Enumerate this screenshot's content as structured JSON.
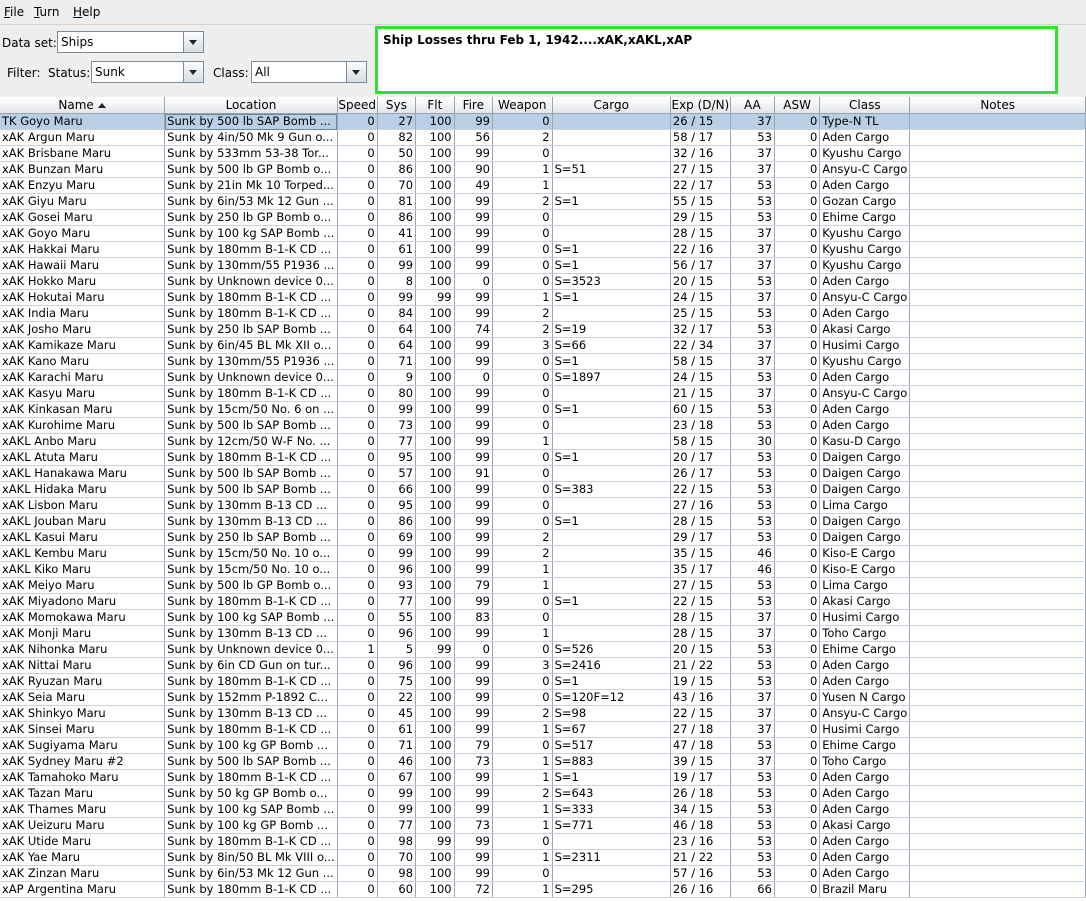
{
  "menu": {
    "file": "File",
    "turn": "Turn",
    "help": "Help"
  },
  "filters": {
    "dataset_label": "Data set:",
    "dataset_value": "Ships",
    "filter_label": "Filter:",
    "status_label": "Status:",
    "status_value": "Sunk",
    "class_label": "Class:",
    "class_value": "All"
  },
  "notes_text": "Ship Losses thru Feb 1, 1942....xAK,xAKL,xAP",
  "columns": [
    "Name",
    "Location",
    "Speed",
    "Sys",
    "Flt",
    "Fire",
    "Weapon",
    "Cargo",
    "Exp (D/N)",
    "AA",
    "ASW",
    "Class",
    "Notes"
  ],
  "rows": [
    [
      "TK Goyo Maru",
      "Sunk by 500 lb SAP Bomb ...",
      "0",
      "27",
      "100",
      "99",
      "0",
      "",
      "26 / 15",
      "37",
      "0",
      "Type-N TL",
      ""
    ],
    [
      "xAK Argun Maru",
      "Sunk by 4in/50 Mk 9 Gun o...",
      "0",
      "82",
      "100",
      "56",
      "2",
      "",
      "58 / 17",
      "53",
      "0",
      "Aden Cargo",
      ""
    ],
    [
      "xAK Brisbane Maru",
      "Sunk by 533mm 53-38 Tor...",
      "0",
      "50",
      "100",
      "99",
      "0",
      "",
      "32 / 16",
      "37",
      "0",
      "Kyushu Cargo",
      ""
    ],
    [
      "xAK Bunzan Maru",
      "Sunk by 500 lb GP Bomb o...",
      "0",
      "86",
      "100",
      "90",
      "1",
      "S=51",
      "27 / 15",
      "37",
      "0",
      "Ansyu-C Cargo",
      ""
    ],
    [
      "xAK Enzyu Maru",
      "Sunk by 21in Mk 10 Torped...",
      "0",
      "70",
      "100",
      "49",
      "1",
      "",
      "22 / 17",
      "53",
      "0",
      "Aden Cargo",
      ""
    ],
    [
      "xAK Giyu Maru",
      "Sunk by 6in/53 Mk 12 Gun ...",
      "0",
      "81",
      "100",
      "99",
      "2",
      "S=1",
      "55 / 15",
      "53",
      "0",
      "Gozan Cargo",
      ""
    ],
    [
      "xAK Gosei Maru",
      "Sunk by 250 lb GP Bomb o...",
      "0",
      "86",
      "100",
      "99",
      "0",
      "",
      "29 / 15",
      "53",
      "0",
      "Ehime Cargo",
      ""
    ],
    [
      "xAK Goyo Maru",
      "Sunk by 100 kg SAP Bomb ...",
      "0",
      "41",
      "100",
      "99",
      "0",
      "",
      "28 / 15",
      "37",
      "0",
      "Kyushu Cargo",
      ""
    ],
    [
      "xAK Hakkai Maru",
      "Sunk by 180mm B-1-K CD ...",
      "0",
      "61",
      "100",
      "99",
      "0",
      "S=1",
      "22 / 16",
      "37",
      "0",
      "Kyushu Cargo",
      ""
    ],
    [
      "xAK Hawaii Maru",
      "Sunk by 130mm/55 P1936 ...",
      "0",
      "99",
      "100",
      "99",
      "0",
      "S=1",
      "56 / 17",
      "37",
      "0",
      "Kyushu Cargo",
      ""
    ],
    [
      "xAK Hokko Maru",
      "Sunk by Unknown device 0...",
      "0",
      "8",
      "100",
      "0",
      "0",
      "S=3523",
      "20 / 15",
      "53",
      "0",
      "Aden Cargo",
      ""
    ],
    [
      "xAK Hokutai Maru",
      "Sunk by 180mm B-1-K CD ...",
      "0",
      "99",
      "99",
      "99",
      "1",
      "S=1",
      "24 / 15",
      "37",
      "0",
      "Ansyu-C Cargo",
      ""
    ],
    [
      "xAK India Maru",
      "Sunk by 180mm B-1-K CD ...",
      "0",
      "84",
      "100",
      "99",
      "2",
      "",
      "25 / 15",
      "53",
      "0",
      "Aden Cargo",
      ""
    ],
    [
      "xAK Josho Maru",
      "Sunk by 250 lb SAP Bomb ...",
      "0",
      "64",
      "100",
      "74",
      "2",
      "S=19",
      "32 / 17",
      "53",
      "0",
      "Akasi Cargo",
      ""
    ],
    [
      "xAK Kamikaze Maru",
      "Sunk by 6in/45 BL Mk XII o...",
      "0",
      "64",
      "100",
      "99",
      "3",
      "S=66",
      "22 / 34",
      "37",
      "0",
      "Husimi Cargo",
      ""
    ],
    [
      "xAK Kano Maru",
      "Sunk by 130mm/55 P1936 ...",
      "0",
      "71",
      "100",
      "99",
      "0",
      "S=1",
      "58 / 15",
      "37",
      "0",
      "Kyushu Cargo",
      ""
    ],
    [
      "xAK Karachi Maru",
      "Sunk by Unknown device 0...",
      "0",
      "9",
      "100",
      "0",
      "0",
      "S=1897",
      "24 / 15",
      "53",
      "0",
      "Aden Cargo",
      ""
    ],
    [
      "xAK Kasyu Maru",
      "Sunk by 180mm B-1-K CD ...",
      "0",
      "80",
      "100",
      "99",
      "0",
      "",
      "21 / 15",
      "37",
      "0",
      "Ansyu-C Cargo",
      ""
    ],
    [
      "xAK Kinkasan Maru",
      "Sunk by 15cm/50 No. 6 on ...",
      "0",
      "99",
      "100",
      "99",
      "0",
      "S=1",
      "60 / 15",
      "53",
      "0",
      "Aden Cargo",
      ""
    ],
    [
      "xAK Kurohime Maru",
      "Sunk by 500 lb SAP Bomb ...",
      "0",
      "73",
      "100",
      "99",
      "0",
      "",
      "23 / 18",
      "53",
      "0",
      "Aden Cargo",
      ""
    ],
    [
      "xAKL Anbo Maru",
      "Sunk by 12cm/50 W-F No. ...",
      "0",
      "77",
      "100",
      "99",
      "1",
      "",
      "58 / 15",
      "30",
      "0",
      "Kasu-D Cargo",
      ""
    ],
    [
      "xAKL Atuta Maru",
      "Sunk by 180mm B-1-K CD ...",
      "0",
      "95",
      "100",
      "99",
      "0",
      "S=1",
      "20 / 17",
      "53",
      "0",
      "Daigen Cargo",
      ""
    ],
    [
      "xAKL Hanakawa Maru",
      "Sunk by 500 lb SAP Bomb ...",
      "0",
      "57",
      "100",
      "91",
      "0",
      "",
      "26 / 17",
      "53",
      "0",
      "Daigen Cargo",
      ""
    ],
    [
      "xAKL Hidaka Maru",
      "Sunk by 500 lb SAP Bomb ...",
      "0",
      "66",
      "100",
      "99",
      "0",
      "S=383",
      "22 / 15",
      "53",
      "0",
      "Daigen Cargo",
      ""
    ],
    [
      "xAK Lisbon Maru",
      "Sunk by 130mm B-13 CD ...",
      "0",
      "95",
      "100",
      "99",
      "0",
      "",
      "27 / 16",
      "53",
      "0",
      "Lima Cargo",
      ""
    ],
    [
      "xAKL Jouban Maru",
      "Sunk by 130mm B-13 CD ...",
      "0",
      "86",
      "100",
      "99",
      "0",
      "S=1",
      "28 / 15",
      "53",
      "0",
      "Daigen Cargo",
      ""
    ],
    [
      "xAKL Kasui Maru",
      "Sunk by 250 lb SAP Bomb ...",
      "0",
      "69",
      "100",
      "99",
      "2",
      "",
      "29 / 17",
      "53",
      "0",
      "Daigen Cargo",
      ""
    ],
    [
      "xAKL Kembu Maru",
      "Sunk by 15cm/50 No. 10 o...",
      "0",
      "99",
      "100",
      "99",
      "2",
      "",
      "35 / 15",
      "46",
      "0",
      "Kiso-E Cargo",
      ""
    ],
    [
      "xAKL Kiko Maru",
      "Sunk by 15cm/50 No. 10 o...",
      "0",
      "96",
      "100",
      "99",
      "1",
      "",
      "35 / 17",
      "46",
      "0",
      "Kiso-E Cargo",
      ""
    ],
    [
      "xAK Meiyo Maru",
      "Sunk by 500 lb GP Bomb o...",
      "0",
      "93",
      "100",
      "79",
      "1",
      "",
      "27 / 15",
      "53",
      "0",
      "Lima Cargo",
      ""
    ],
    [
      "xAK Miyadono Maru",
      "Sunk by 180mm B-1-K CD ...",
      "0",
      "77",
      "100",
      "99",
      "0",
      "S=1",
      "22 / 15",
      "53",
      "0",
      "Akasi Cargo",
      ""
    ],
    [
      "xAK Momokawa Maru",
      "Sunk by 100 kg SAP Bomb ...",
      "0",
      "55",
      "100",
      "83",
      "0",
      "",
      "28 / 15",
      "37",
      "0",
      "Husimi Cargo",
      ""
    ],
    [
      "xAK Monji Maru",
      "Sunk by 130mm B-13 CD ...",
      "0",
      "96",
      "100",
      "99",
      "1",
      "",
      "28 / 15",
      "37",
      "0",
      "Toho Cargo",
      ""
    ],
    [
      "xAK Nihonka Maru",
      "Sunk by Unknown device 0...",
      "1",
      "5",
      "99",
      "0",
      "0",
      "S=526",
      "20 / 15",
      "53",
      "0",
      "Ehime Cargo",
      ""
    ],
    [
      "xAK Nittai Maru",
      "Sunk by 6in CD Gun on tur...",
      "0",
      "96",
      "100",
      "99",
      "3",
      "S=2416",
      "21 / 22",
      "53",
      "0",
      "Aden Cargo",
      ""
    ],
    [
      "xAK Ryuzan Maru",
      "Sunk by 180mm B-1-K CD ...",
      "0",
      "75",
      "100",
      "99",
      "0",
      "S=1",
      "19 / 15",
      "53",
      "0",
      "Aden Cargo",
      ""
    ],
    [
      "xAK Seia Maru",
      "Sunk by 152mm P-1892 C...",
      "0",
      "22",
      "100",
      "99",
      "0",
      "S=120F=12",
      "43 / 16",
      "37",
      "0",
      "Yusen N Cargo",
      ""
    ],
    [
      "xAK Shinkyo Maru",
      "Sunk by 130mm B-13 CD ...",
      "0",
      "45",
      "100",
      "99",
      "2",
      "S=98",
      "22 / 15",
      "37",
      "0",
      "Ansyu-C Cargo",
      ""
    ],
    [
      "xAK Sinsei Maru",
      "Sunk by 180mm B-1-K CD ...",
      "0",
      "61",
      "100",
      "99",
      "1",
      "S=67",
      "27 / 18",
      "37",
      "0",
      "Husimi Cargo",
      ""
    ],
    [
      "xAK Sugiyama Maru",
      "Sunk by 100 kg GP Bomb ...",
      "0",
      "71",
      "100",
      "79",
      "0",
      "S=517",
      "47 / 18",
      "53",
      "0",
      "Ehime Cargo",
      ""
    ],
    [
      "xAK Sydney Maru #2",
      "Sunk by 500 lb SAP Bomb ...",
      "0",
      "46",
      "100",
      "73",
      "1",
      "S=883",
      "39 / 15",
      "37",
      "0",
      "Toho Cargo",
      ""
    ],
    [
      "xAK Tamahoko Maru",
      "Sunk by 180mm B-1-K CD ...",
      "0",
      "67",
      "100",
      "99",
      "1",
      "S=1",
      "19 / 17",
      "53",
      "0",
      "Aden Cargo",
      ""
    ],
    [
      "xAK Tazan Maru",
      "Sunk by 50 kg GP Bomb o...",
      "0",
      "99",
      "100",
      "99",
      "2",
      "S=643",
      "26 / 18",
      "53",
      "0",
      "Aden Cargo",
      ""
    ],
    [
      "xAK Thames Maru",
      "Sunk by 100 kg SAP Bomb ...",
      "0",
      "99",
      "100",
      "99",
      "1",
      "S=333",
      "34 / 15",
      "53",
      "0",
      "Aden Cargo",
      ""
    ],
    [
      "xAK Ueizuru Maru",
      "Sunk by 100 kg GP Bomb ...",
      "0",
      "77",
      "100",
      "73",
      "1",
      "S=771",
      "46 / 18",
      "53",
      "0",
      "Akasi Cargo",
      ""
    ],
    [
      "xAK Utide Maru",
      "Sunk by 180mm B-1-K CD ...",
      "0",
      "98",
      "99",
      "99",
      "0",
      "",
      "23 / 16",
      "53",
      "0",
      "Aden Cargo",
      ""
    ],
    [
      "xAK Yae Maru",
      "Sunk by 8in/50 BL Mk VIII o...",
      "0",
      "70",
      "100",
      "99",
      "1",
      "S=2311",
      "21 / 22",
      "53",
      "0",
      "Aden Cargo",
      ""
    ],
    [
      "xAK Zinzan Maru",
      "Sunk by 6in/53 Mk 12 Gun ...",
      "0",
      "98",
      "100",
      "99",
      "0",
      "",
      "57 / 16",
      "53",
      "0",
      "Aden Cargo",
      ""
    ],
    [
      "xAP Argentina Maru",
      "Sunk by 180mm B-1-K CD ...",
      "0",
      "60",
      "100",
      "72",
      "1",
      "S=295",
      "26 / 16",
      "66",
      "0",
      "Brazil Maru",
      ""
    ]
  ],
  "selected_row": 0
}
